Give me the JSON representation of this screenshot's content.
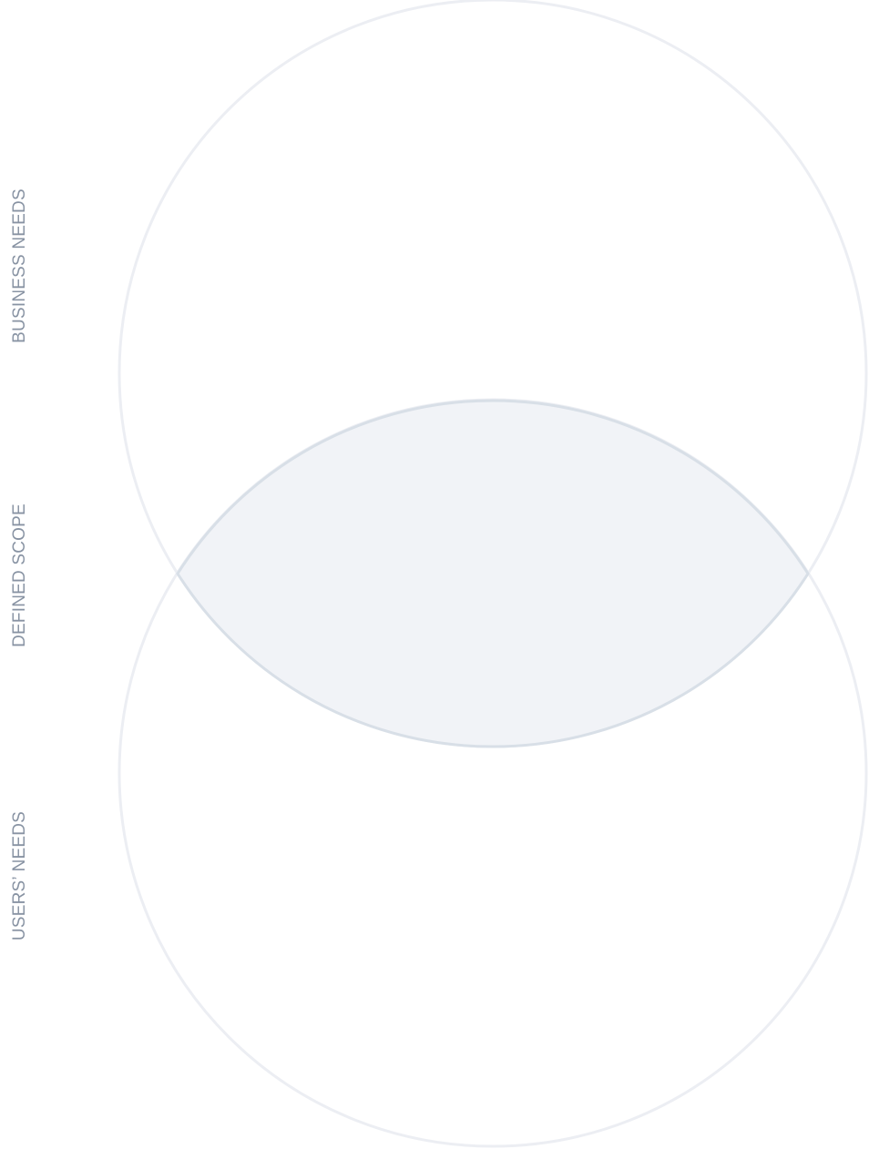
{
  "labels": {
    "business_needs": "BUSINESS NEEDS",
    "defined_scope": "DEFINED SCOPE",
    "users_needs": "USERS’ NEEDS"
  },
  "colors": {
    "background": "#ffffff",
    "circle_stroke": "#eceef3",
    "intersection_fill": "#f1f3f7",
    "intersection_stroke": "#d8dfe7",
    "label_text": "#8893a3"
  }
}
